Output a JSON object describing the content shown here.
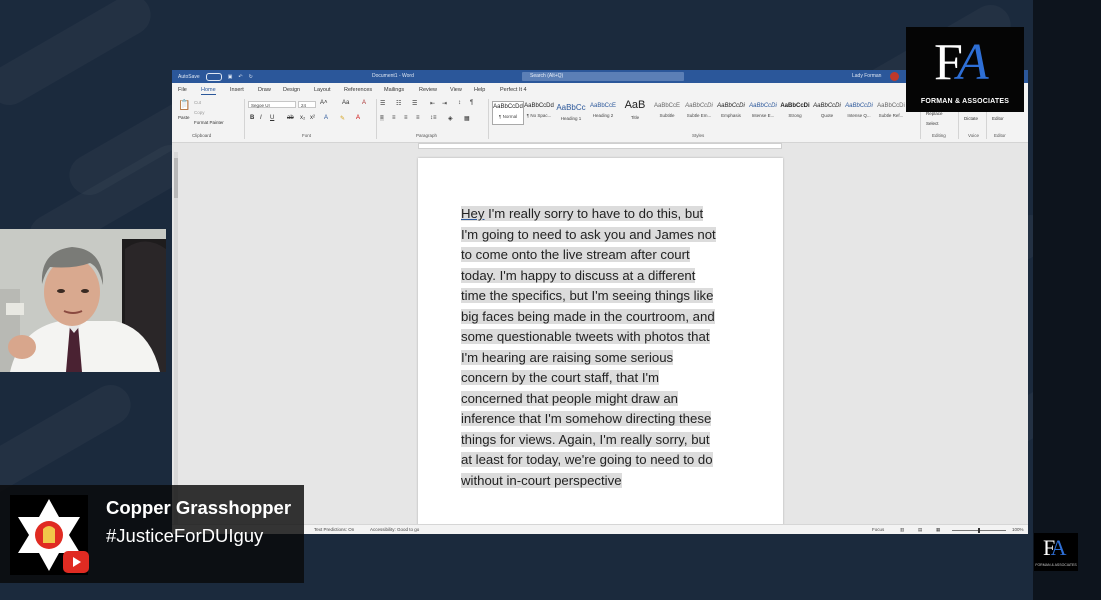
{
  "word": {
    "title_bar": {
      "autosave": "AutoSave",
      "autosave_state": "Off",
      "doc_name": "Document1 - Word",
      "search_placeholder": "Search (Alt+Q)",
      "user": "Lady Forman"
    },
    "menu": [
      "File",
      "Home",
      "Insert",
      "Draw",
      "Design",
      "Layout",
      "References",
      "Mailings",
      "Review",
      "View",
      "Help",
      "Perfect It 4"
    ],
    "active_menu": "Home",
    "ribbon": {
      "clipboard": {
        "paste": "Paste",
        "cut": "Cut",
        "copy": "Copy",
        "format_painter": "Format Painter",
        "label": "Clipboard"
      },
      "font": {
        "name": "Segoe UI",
        "size": "24",
        "label": "Font"
      },
      "paragraph": {
        "label": "Paragraph"
      },
      "styles": {
        "items": [
          {
            "sample": "AaBbCcDd",
            "name": "¶ Normal"
          },
          {
            "sample": "AaBbCcDd",
            "name": "¶ No Spac..."
          },
          {
            "sample": "AaBbCc",
            "name": "Heading 1"
          },
          {
            "sample": "AaBbCcE",
            "name": "Heading 2"
          },
          {
            "sample": "AaB",
            "name": "Title"
          },
          {
            "sample": "AaBbCcE",
            "name": "Subtitle"
          },
          {
            "sample": "AaBbCcDi",
            "name": "Subtle Em..."
          },
          {
            "sample": "AaBbCcDi",
            "name": "Emphasis"
          },
          {
            "sample": "AaBbCcDi",
            "name": "Intense E..."
          },
          {
            "sample": "AaBbCcDi",
            "name": "Strong"
          },
          {
            "sample": "AaBbCcDi",
            "name": "Quote"
          },
          {
            "sample": "AaBbCcDi",
            "name": "Intense Q..."
          },
          {
            "sample": "AaBbCcDi",
            "name": "Subtle Ref..."
          }
        ],
        "label": "Styles"
      },
      "editing": {
        "replace": "Replace",
        "select": "Select",
        "label": "Editing"
      },
      "voice": {
        "dictate": "Dictate",
        "label": "Voice"
      },
      "editor": {
        "editor": "Editor",
        "label": "Editor"
      }
    },
    "document": {
      "first_word": "Hey",
      "lines": [
        " I'm really sorry to have to do this, but",
        "I'm going to need to ask you and James not",
        "to come onto the live stream after court",
        "today. I'm happy to discuss at a different",
        "time the specifics, but I'm seeing things like",
        "big faces being made in the courtroom, and",
        "some questionable tweets with photos that",
        "I'm hearing are raising some serious",
        "concern by the court staff, that I'm",
        "concerned that people might draw an",
        "inference that I'm somehow directing these",
        "things for views. Again, I'm really sorry, but",
        "at least for today, we're going to need to do",
        "without in-court perspective"
      ]
    },
    "status": {
      "predictions": "Text Predictions: On",
      "accessibility": "Accessibility: Good to go",
      "focus": "Focus",
      "zoom": "100%"
    }
  },
  "logo": {
    "letter_f": "F",
    "letter_a": "A",
    "name": "FORMAN & ASSOCIATES",
    "colors": {
      "f": "#ffffff",
      "a": "#2e6fd6"
    }
  },
  "chat": {
    "author": "Copper Grasshopper",
    "message": "#JusticeForDUIguy"
  }
}
